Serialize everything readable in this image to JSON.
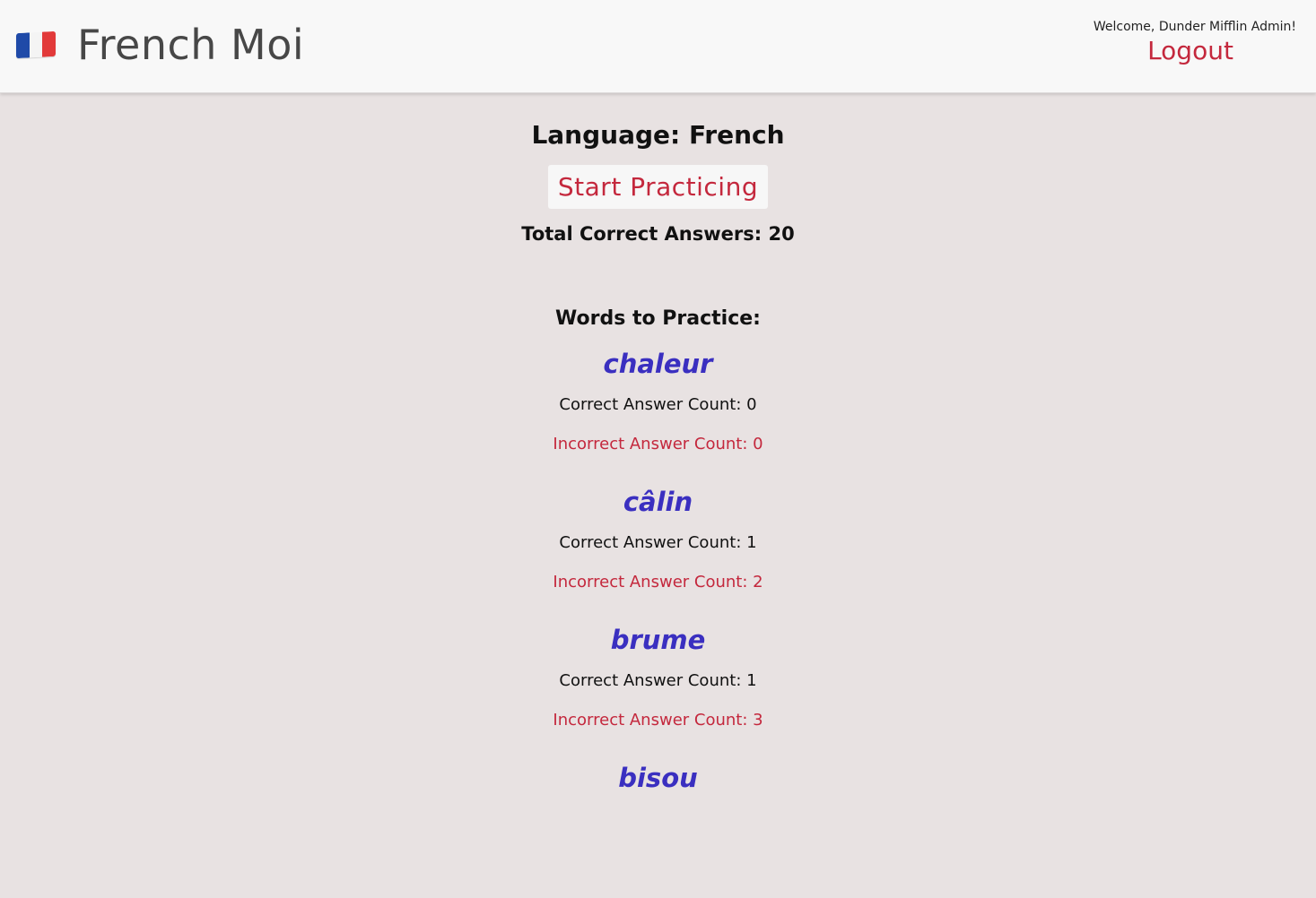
{
  "header": {
    "app_title": "French Moi",
    "flag_icon": "france-flag-icon",
    "welcome_text": "Welcome, Dunder Mifflin Admin!",
    "logout_label": "Logout"
  },
  "main": {
    "language_label": "Language: French",
    "start_button_label": "Start Practicing",
    "total_correct_label": "Total Correct Answers: 20",
    "words_heading": "Words to Practice:",
    "words": [
      {
        "word": "chaleur",
        "correct": "Correct Answer Count: 0",
        "incorrect": "Incorrect Answer Count: 0"
      },
      {
        "word": "câlin",
        "correct": "Correct Answer Count: 1",
        "incorrect": "Incorrect Answer Count: 2"
      },
      {
        "word": "brume",
        "correct": "Correct Answer Count: 1",
        "incorrect": "Incorrect Answer Count: 3"
      },
      {
        "word": "bisou",
        "correct": "",
        "incorrect": ""
      }
    ]
  },
  "colors": {
    "accent": "#c4283d",
    "word": "#3a2fc0",
    "background": "#e8e2e2",
    "header_bg": "#f8f8f8"
  }
}
